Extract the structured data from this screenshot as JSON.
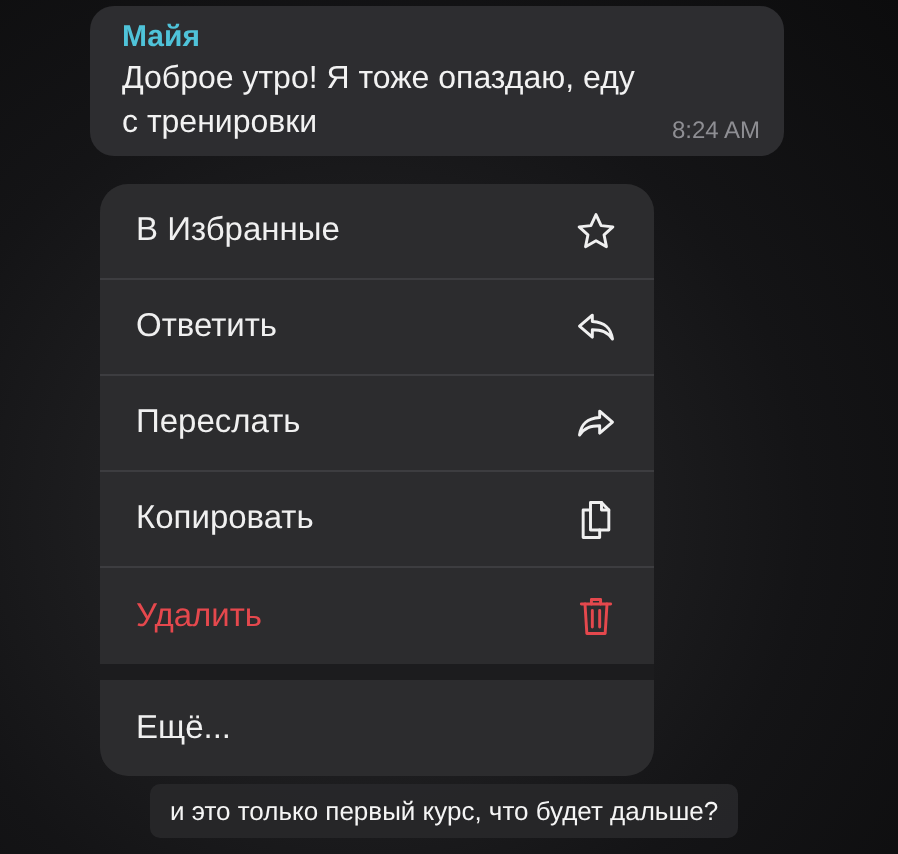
{
  "message": {
    "sender": "Майя",
    "text": "Доброе утро! Я тоже опаздаю, еду с тренировки",
    "time": "8:24 AM"
  },
  "menu": {
    "items": [
      {
        "label": "В Избранные",
        "kind": "normal"
      },
      {
        "label": "Ответить",
        "kind": "normal"
      },
      {
        "label": "Переслать",
        "kind": "normal"
      },
      {
        "label": "Копировать",
        "kind": "normal"
      },
      {
        "label": "Удалить",
        "kind": "destructive"
      }
    ],
    "more": {
      "label": "Ещё..."
    }
  },
  "subtitle": "и это только первый курс, что будет дальше?"
}
